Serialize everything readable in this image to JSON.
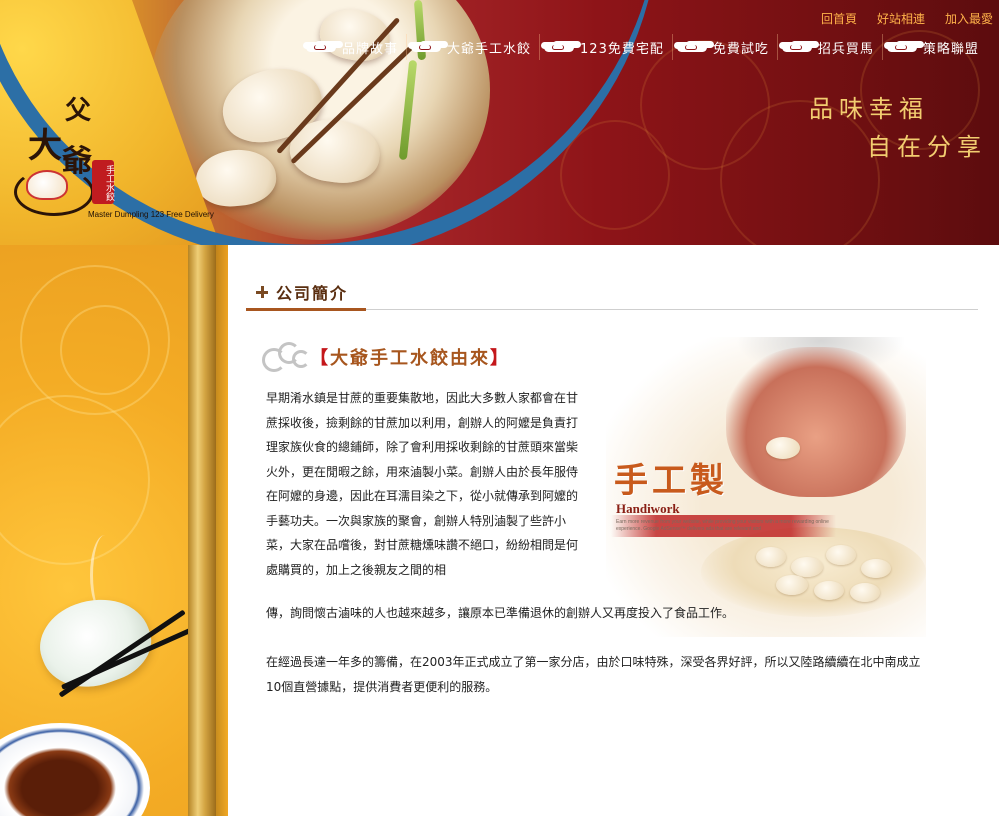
{
  "brand": {
    "logo_chars": [
      "大",
      "爺"
    ],
    "stamp_text": "手工水餃",
    "tagline": "Master Dumpling 123 Free Delivery"
  },
  "top_links": [
    {
      "label": "回首頁"
    },
    {
      "label": "好站相連"
    },
    {
      "label": "加入最愛"
    }
  ],
  "main_nav": [
    {
      "label": "品牌故事",
      "icon": "cloud-icon"
    },
    {
      "label": "大爺手工水餃",
      "icon": "cloud-icon"
    },
    {
      "label": "123免費宅配",
      "icon": "cloud-icon"
    },
    {
      "label": "免費試吃",
      "icon": "cloud-icon"
    },
    {
      "label": "招兵買馬",
      "icon": "cloud-icon"
    },
    {
      "label": "策略聯盟",
      "icon": "cloud-icon"
    }
  ],
  "slogan": {
    "line1": "品味幸福",
    "line2": "自在分享"
  },
  "section": {
    "title": "公司簡介"
  },
  "subheading": {
    "open": "【",
    "text": "大爺手工水餃由來",
    "close": "】"
  },
  "handiwork": {
    "big": "手工製",
    "eng": "Handiwork",
    "small": "Earn more revenue from your website, while providing your visitors with a more rewarding online experience. Google AdSense™ delivers ads that are relevant and"
  },
  "paragraphs": {
    "p1": "早期淆水鎮是甘蔗的重要集散地，因此大多數人家都會在甘蔗採收後，撿剩餘的甘蔗加以利用，創辦人的阿嬤是負責打理家族伙食的總鋪師，除了會利用採收剩餘的甘蔗頭來當柴火外，更在閒暇之餘，用來滷製小菜。創辦人由於長年服侍在阿嬤的身邊，因此在耳濡目染之下，從小就傳承到阿嬤的手藝功夫。一次與家族的聚會，創辦人特別滷製了些許小菜，大家在品嚐後，對甘蔗糖燻味讚不絕口，紛紛相問是何處購買的，加上之後親友之間的相",
    "p2": "傳，詢問懷古滷味的人也越來越多，讓原本已準備退休的創辦人又再度投入了食品工作。",
    "p3": "在經過長達一年多的籌備，在2003年正式成立了第一家分店，由於口味特殊，深受各界好評，所以又陸路續續在北中南成立10個直營據點，提供消費者更便利的服務。"
  },
  "colors": {
    "header_red": "#8e1418",
    "gold_text": "#f2cd70",
    "top_link": "#ffb24a",
    "section_brown": "#5a2e10",
    "subheading_orange": "#a7561e",
    "sidebar_yellow": "#f4ac25"
  }
}
